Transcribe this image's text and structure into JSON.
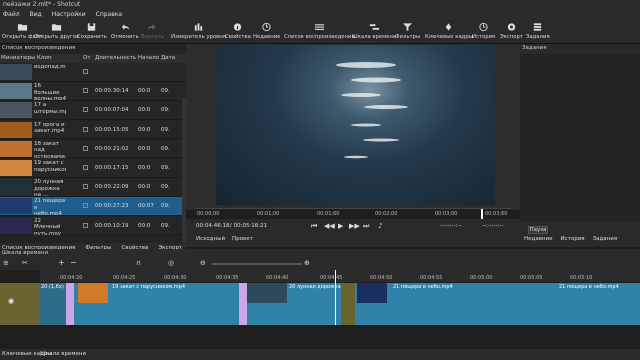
{
  "window": {
    "title": "пейзажи 2.mlt* - Shotcut"
  },
  "menu": [
    "Файл",
    "Вид",
    "Настройки",
    "Справка"
  ],
  "toolbar": [
    {
      "label": "Открыть файл",
      "icon": "folder-icon"
    },
    {
      "label": "Открыть другое",
      "icon": "folder-plus-icon"
    },
    {
      "label": "Сохранить",
      "icon": "save-icon"
    },
    {
      "label": "Отменить",
      "icon": "undo-icon"
    },
    {
      "label": "Вернуть",
      "icon": "redo-icon"
    },
    {
      "label": "Измеритель уровня",
      "icon": "meter-icon"
    },
    {
      "label": "Свойства",
      "icon": "info-icon"
    },
    {
      "label": "Недавние",
      "icon": "clock-icon"
    },
    {
      "label": "Список воспроизведения",
      "icon": "playlist-icon"
    },
    {
      "label": "Шкала времени",
      "icon": "timeline-icon"
    },
    {
      "label": "Фильтры",
      "icon": "filter-icon"
    },
    {
      "label": "Ключевые кадры",
      "icon": "keyframes-icon"
    },
    {
      "label": "История",
      "icon": "history-icon"
    },
    {
      "label": "Экспорт",
      "icon": "export-icon"
    },
    {
      "label": "Задания",
      "icon": "jobs-icon"
    }
  ],
  "playlist": {
    "title": "Список воспроизведения",
    "columns": [
      "Миниатюры",
      "Клип",
      "От",
      "Длительность",
      "Начало",
      "Дата"
    ],
    "rows": [
      {
        "clip": "водопад.mov",
        "duration": "",
        "start": "",
        "date": "",
        "thumb": "#3a4a5a",
        "sel": false
      },
      {
        "clip": "16 большие волны.mp4",
        "duration": "00:00:30:14",
        "start": "00:0",
        "date": "09.",
        "thumb": "#5a7a8a",
        "sel": false
      },
      {
        "clip": "17 а штормы.mp4",
        "duration": "00:00:07:04",
        "start": "00:0",
        "date": "09.",
        "thumb": "#4a5560",
        "sel": false
      },
      {
        "clip": "17 орога и закат.mp4",
        "duration": "00:00:15:05",
        "start": "00:0",
        "date": "09.",
        "thumb": "#a05a20",
        "sel": false
      },
      {
        "clip": "18 закат над островами.mp4",
        "duration": "00:00:21:02",
        "start": "00:0",
        "date": "09.",
        "thumb": "#c07030",
        "sel": false
      },
      {
        "clip": "19 закат с парусником.mp4",
        "duration": "00:00:17:15",
        "start": "00:0",
        "date": "09.",
        "thumb": "#d08840",
        "sel": false
      },
      {
        "clip": "20 лунная дорожка на ...",
        "duration": "00:00:22:09",
        "start": "00:0",
        "date": "09.",
        "thumb": "#20303a",
        "sel": false
      },
      {
        "clip": "21 пещера в небо.mp4",
        "duration": "00:00:27:23",
        "start": "00:07",
        "date": "09.",
        "thumb": "#203a70",
        "sel": true
      },
      {
        "clip": "22 Млечный путь.mov",
        "duration": "00:00:10:19",
        "start": "00:0",
        "date": "09.",
        "thumb": "#2a2a50",
        "sel": false
      }
    ],
    "footer_tabs": [
      "Список воспроизведения",
      "Фильтры",
      "Свойства",
      "Экспорт"
    ]
  },
  "player": {
    "ruler": [
      "00:00;00",
      "00:01;00",
      "00:01;60",
      "00:02;00",
      "00:03;00",
      "00:03;60"
    ],
    "timecode": "00:04:46:18",
    "duration": "/ 00:05:16:21",
    "in_out": "--:--:--:--",
    "tabs": [
      "Исходный",
      "Проект"
    ]
  },
  "jobs": {
    "title": "Задания",
    "pause": "Пауза",
    "tabs": [
      "Недавние",
      "История",
      "Задания"
    ]
  },
  "timeline": {
    "title": "Шкала времени",
    "ruler": [
      "00:04:20",
      "00:04:25",
      "00:04:30",
      "00:04:35",
      "00:04:40",
      "00:04:45",
      "00:04:50",
      "00:04:55",
      "00:05:00",
      "00:05:05",
      "00:05:10"
    ],
    "clips": [
      {
        "label": "20 (1,6x)",
        "color": "#2c6d8c"
      },
      {
        "label": "19 закат с парусником.mp4",
        "color": "#3182a8"
      },
      {
        "label": "20 лунная дорожка на",
        "color": "#3182a8"
      },
      {
        "label": "21 пещера в небо.mp4",
        "color": "#3182a8"
      },
      {
        "label": "21 пещера в небо.mp4",
        "color": "#3182a8"
      }
    ]
  },
  "bottom_tabs": [
    "Ключевые кадры",
    "Шкала времени"
  ]
}
